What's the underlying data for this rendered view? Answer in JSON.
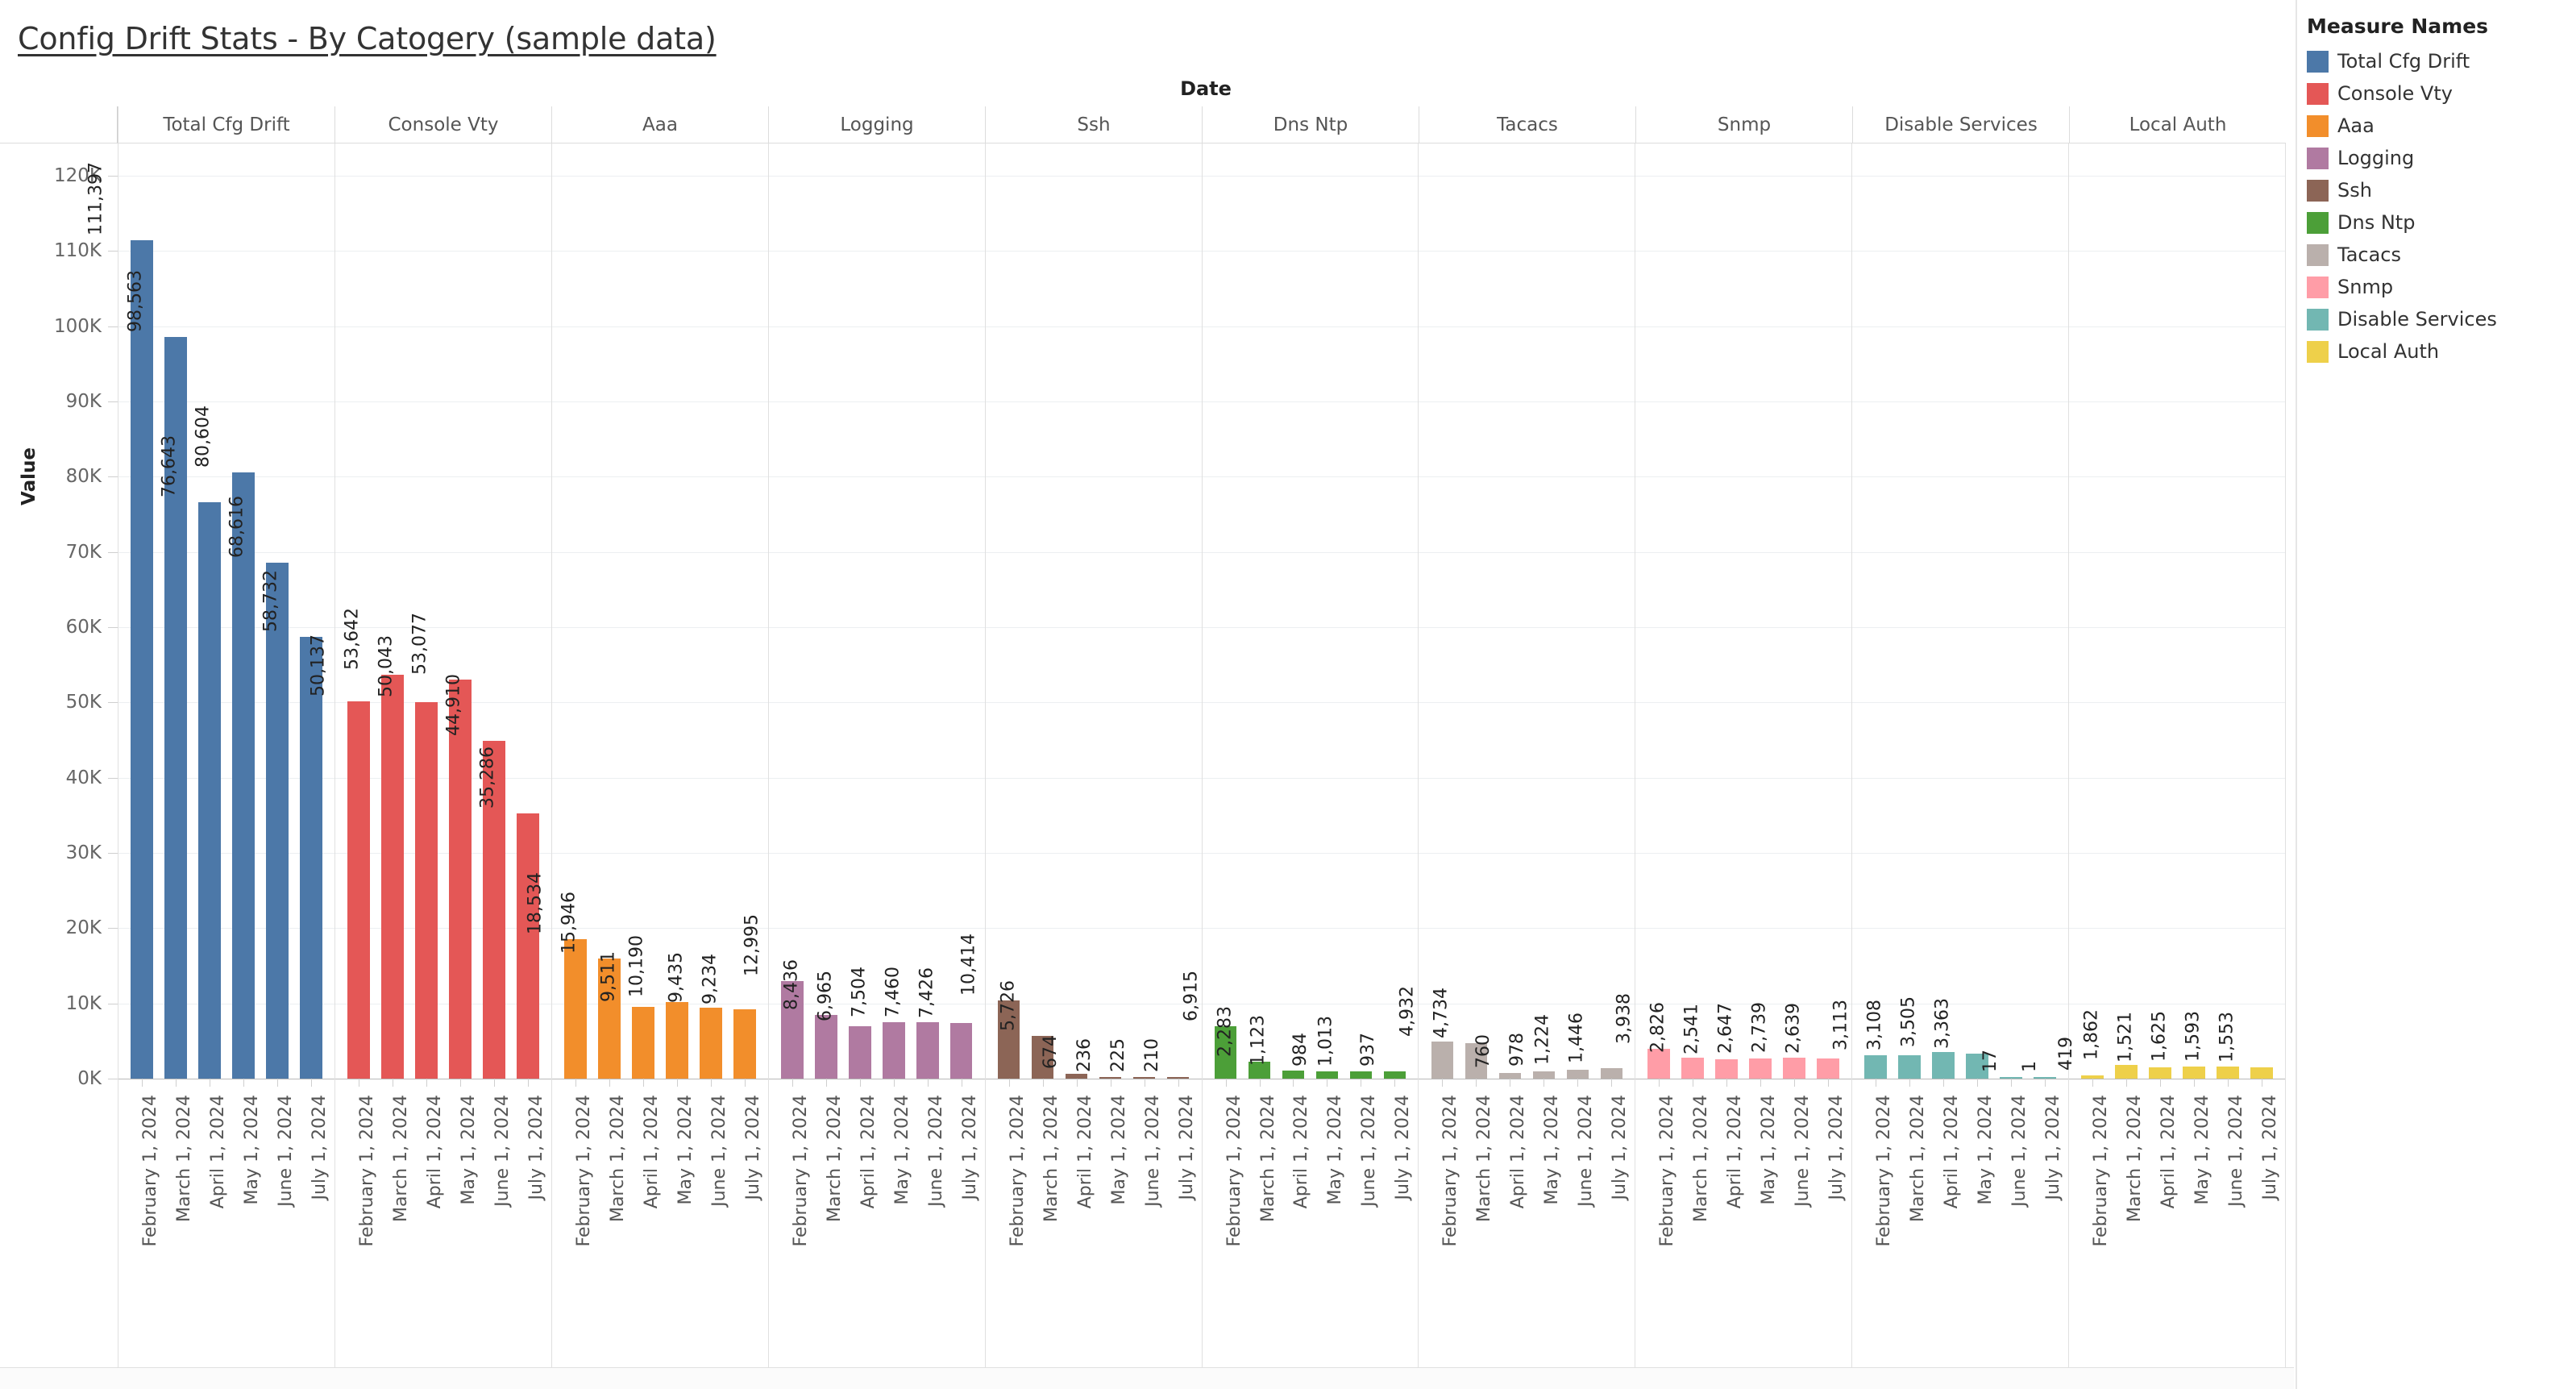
{
  "title": "Config Drift Stats - By Catogery (sample data)",
  "legend": {
    "title": "Measure Names",
    "items": [
      {
        "label": "Total Cfg Drift",
        "color": "#4c78a8"
      },
      {
        "label": "Console Vty",
        "color": "#e45756"
      },
      {
        "label": "Aaa",
        "color": "#f28e2b"
      },
      {
        "label": "Logging",
        "color": "#b07aa1"
      },
      {
        "label": "Ssh",
        "color": "#8c6556"
      },
      {
        "label": "Dns Ntp",
        "color": "#4c9f38"
      },
      {
        "label": "Tacacs",
        "color": "#bab0ac"
      },
      {
        "label": "Snmp",
        "color": "#ff9da7"
      },
      {
        "label": "Disable Services",
        "color": "#72b7b2"
      },
      {
        "label": "Local Auth",
        "color": "#eed04a"
      }
    ]
  },
  "axes": {
    "column_header": "Date",
    "y_title": "Value",
    "y_ticks": [
      "120K",
      "110K",
      "100K",
      "90K",
      "80K",
      "70K",
      "60K",
      "50K",
      "40K",
      "30K",
      "20K",
      "10K",
      "0K"
    ],
    "y_min": 0,
    "y_max": 120000,
    "x_categories": [
      "February 1, 2024",
      "March 1, 2024",
      "April 1, 2024",
      "May 1, 2024",
      "June 1, 2024",
      "July 1, 2024"
    ]
  },
  "chart_data": {
    "type": "bar",
    "title": "Config Drift Stats - By Catogery (sample data)",
    "xlabel": "Date",
    "ylabel": "Value",
    "ylim": [
      0,
      120000
    ],
    "grid": true,
    "legend_position": "right",
    "legend_title": "Measure Names",
    "categories": [
      "February 1, 2024",
      "March 1, 2024",
      "April 1, 2024",
      "May 1, 2024",
      "June 1, 2024",
      "July 1, 2024"
    ],
    "panels": [
      {
        "name": "Total Cfg Drift",
        "color": "#4c78a8",
        "values": [
          111397,
          98563,
          76643,
          80604,
          68616,
          58732
        ],
        "labels": [
          "111,397",
          "98,563",
          "76,643",
          "80,604",
          "68,616",
          "58,732"
        ]
      },
      {
        "name": "Console Vty",
        "color": "#e45756",
        "values": [
          50137,
          53642,
          50043,
          53077,
          44910,
          35286
        ],
        "labels": [
          "50,137",
          "53,642",
          "50,043",
          "53,077",
          "44,910",
          "35,286"
        ]
      },
      {
        "name": "Aaa",
        "color": "#f28e2b",
        "values": [
          18534,
          15946,
          9511,
          10190,
          9435,
          9234
        ],
        "labels": [
          "18,534",
          "15,946",
          "9,511",
          "10,190",
          "9,435",
          "9,234"
        ]
      },
      {
        "name": "Logging",
        "color": "#b07aa1",
        "values": [
          12995,
          8436,
          6965,
          7504,
          7460,
          7426
        ],
        "labels": [
          "12,995",
          "8,436",
          "6,965",
          "7,504",
          "7,460",
          "7,426"
        ]
      },
      {
        "name": "Ssh",
        "color": "#8c6556",
        "values": [
          10414,
          5726,
          674,
          236,
          225,
          210
        ],
        "labels": [
          "10,414",
          "5,726",
          "674",
          "236",
          "225",
          "210"
        ]
      },
      {
        "name": "Dns Ntp",
        "color": "#4c9f38",
        "values": [
          6915,
          2283,
          1123,
          984,
          1013,
          937
        ],
        "labels": [
          "6,915",
          "2,283",
          "1,123",
          "984",
          "1,013",
          "937"
        ]
      },
      {
        "name": "Tacacs",
        "color": "#bab0ac",
        "values": [
          4932,
          4734,
          760,
          978,
          1224,
          1446
        ],
        "labels": [
          "4,932",
          "4,734",
          "760",
          "978",
          "1,224",
          "1,446"
        ]
      },
      {
        "name": "Snmp",
        "color": "#ff9da7",
        "values": [
          3938,
          2826,
          2541,
          2647,
          2739,
          2639
        ],
        "labels": [
          "3,938",
          "2,826",
          "2,541",
          "2,647",
          "2,739",
          "2,639"
        ]
      },
      {
        "name": "Disable Services",
        "color": "#72b7b2",
        "values": [
          3113,
          3108,
          3505,
          3363,
          17,
          1
        ],
        "labels": [
          "3,113",
          "3,108",
          "3,505",
          "3,363",
          "17",
          "1"
        ]
      },
      {
        "name": "Local Auth",
        "color": "#eed04a",
        "values": [
          419,
          1862,
          1521,
          1625,
          1593,
          1553
        ],
        "labels": [
          "419",
          "1,862",
          "1,521",
          "1,625",
          "1,593",
          "1,553"
        ]
      }
    ]
  }
}
